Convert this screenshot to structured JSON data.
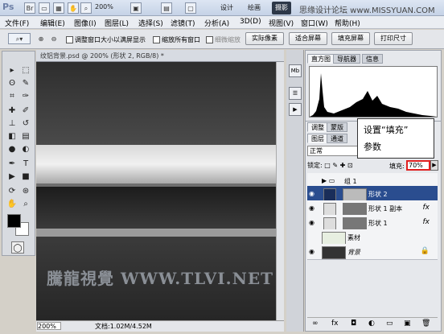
{
  "titlebar": {
    "logo": "Ps",
    "zoom": "200%",
    "workspaces": [
      "设计",
      "绘画",
      "摄影"
    ],
    "watermark": "思缘设计论坛 www.MISSYUAN.COM"
  },
  "menu": [
    "文件(F)",
    "编辑(E)",
    "图像(I)",
    "图层(L)",
    "选择(S)",
    "滤镜(T)",
    "分析(A)",
    "3D(D)",
    "视图(V)",
    "窗口(W)",
    "帮助(H)"
  ],
  "options": {
    "chk_resize": "调整窗口大小以满屏显示",
    "chk_all": "缩放所有窗口",
    "chk_scrub": "细微缩放",
    "btn_actual": "实际像素",
    "btn_fit": "适合屏幕",
    "btn_fill": "填充屏幕",
    "btn_print": "打印尺寸"
  },
  "document": {
    "title": "纹铝背景.psd @ 200% (形状 2, RGB/8) *",
    "zoom": "200%",
    "info": "文档:1.02M/4.52M",
    "watermark": "騰龍視覺 WWW.TLVI.NET"
  },
  "histogram": {
    "tabs": [
      "直方图",
      "导航器",
      "信息"
    ]
  },
  "layers": {
    "tabs_top": [
      "调整",
      "蒙版"
    ],
    "tabs_main": [
      "图层",
      "通道"
    ],
    "blend_mode": "正常",
    "lock_label": "锁定:",
    "fill_label": "填充:",
    "fill_value": "70%",
    "items": [
      {
        "name": "组 1"
      },
      {
        "name": "形状 2"
      },
      {
        "name": "形状 1 副本",
        "fx": "fx"
      },
      {
        "name": "形状 1",
        "fx": "fx"
      },
      {
        "name": "素材"
      },
      {
        "name": "背景"
      }
    ]
  },
  "callout": {
    "line1": "设置“填充”",
    "line2": "参数"
  }
}
